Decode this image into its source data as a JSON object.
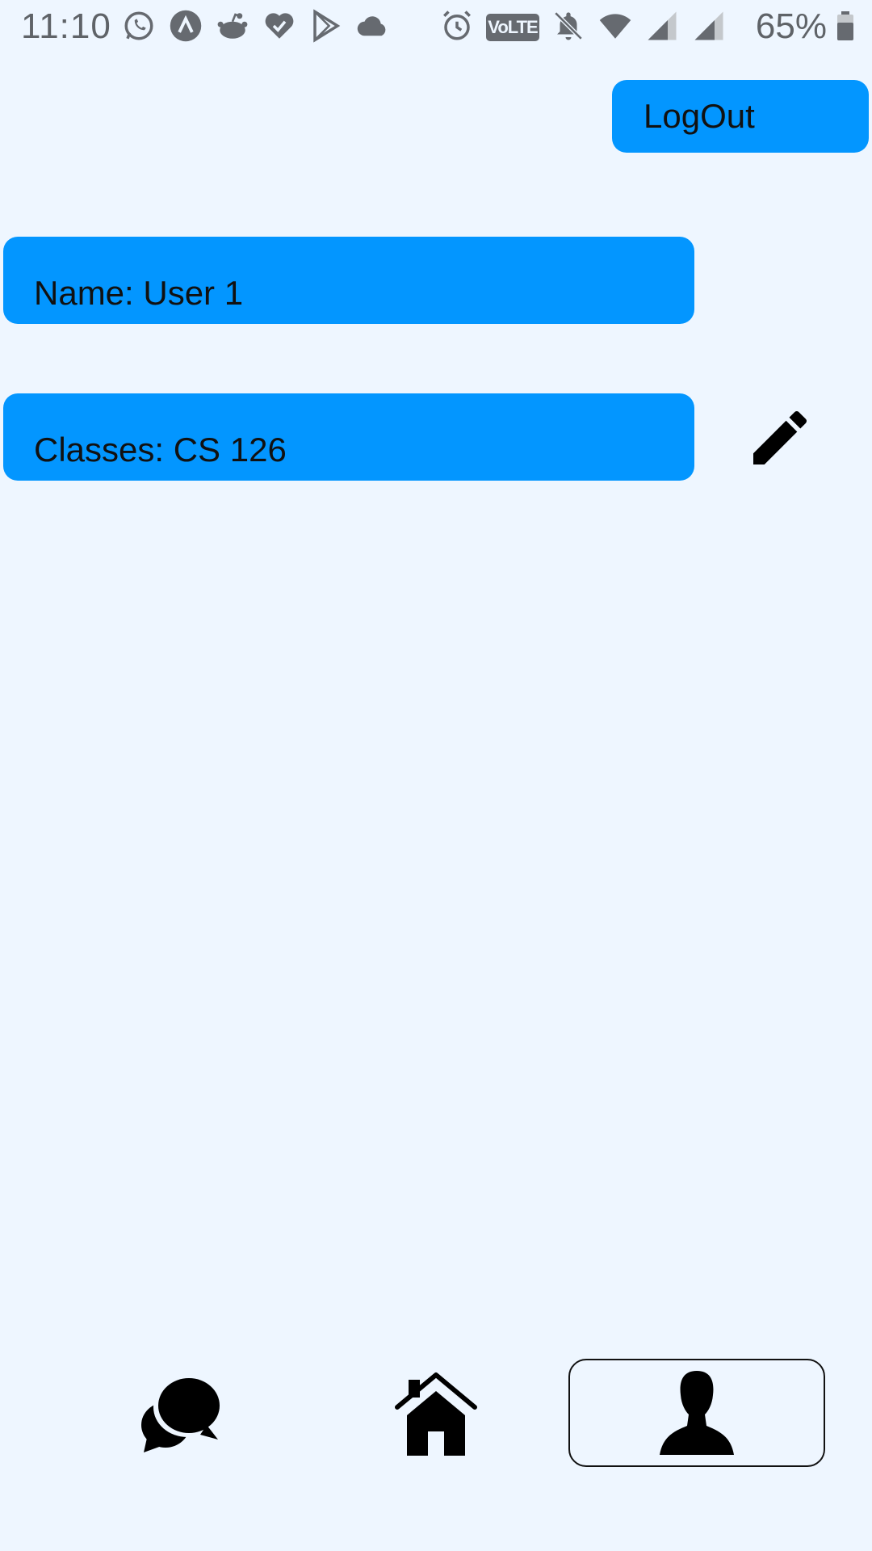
{
  "status_bar": {
    "time": "11:10",
    "left_icons": [
      "whatsapp-icon",
      "arc-icon",
      "reddit-icon",
      "heart-check-icon",
      "play-store-icon",
      "cloud-icon"
    ],
    "volte_label": "VoLTE",
    "right_icons": [
      "alarm-icon",
      "volte-icon",
      "notifications-off-icon",
      "wifi-icon",
      "signal-icon",
      "signal-icon-2"
    ],
    "battery_percent": "65%"
  },
  "header": {
    "logout_label": "LogOut"
  },
  "profile": {
    "name_text": "Name: User 1",
    "classes_text": "Classes: CS 126"
  },
  "bottom_nav": {
    "items": [
      {
        "name": "chat",
        "icon": "chat-icon"
      },
      {
        "name": "home",
        "icon": "home-icon"
      },
      {
        "name": "profile",
        "icon": "profile-icon",
        "selected": true
      }
    ]
  },
  "colors": {
    "background": "#eef6ff",
    "accent": "#0396ff",
    "status_gray": "#5f6368"
  }
}
